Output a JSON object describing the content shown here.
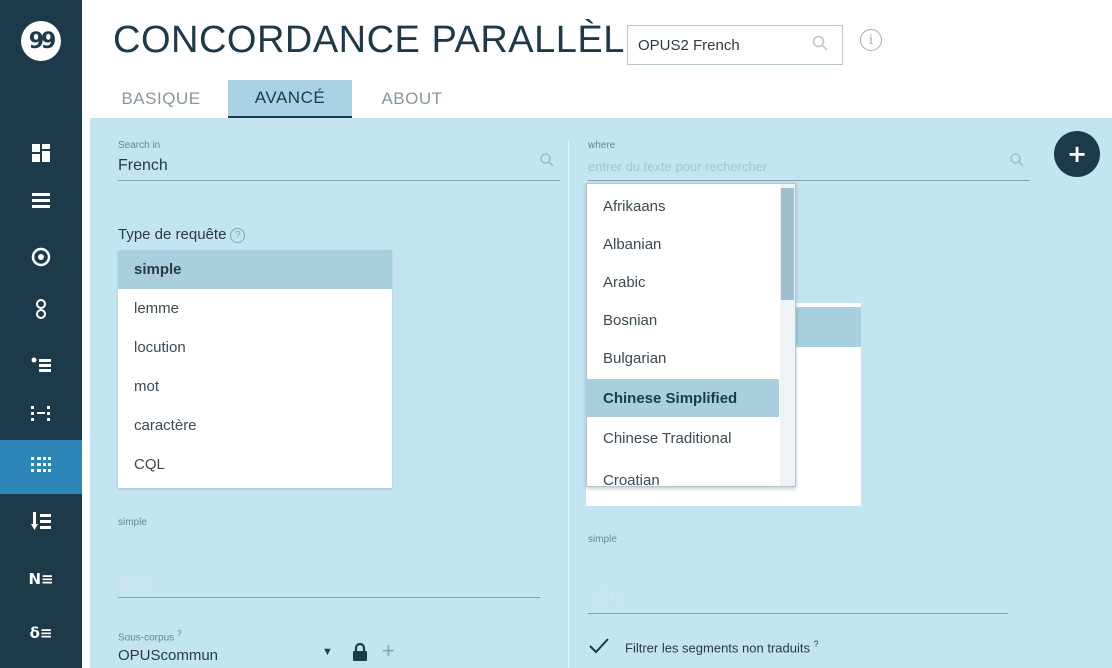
{
  "app": {
    "title": "CONCORDANCE PARALLÈLE",
    "corpus": "OPUS2 French",
    "logo": "99"
  },
  "sidebar": {
    "items": [
      {
        "icon": "dashboard-icon",
        "glyph": "▦"
      },
      {
        "icon": "list-icon",
        "glyph": "☰"
      },
      {
        "icon": "target-icon",
        "glyph": "⊙"
      },
      {
        "icon": "link-icon",
        "glyph": "8"
      },
      {
        "icon": "bullet-list-icon",
        "glyph": "•≡"
      },
      {
        "icon": "dots-list-icon",
        "glyph": "⁞⁝"
      },
      {
        "icon": "parallel-icon",
        "glyph": "⁞⁞",
        "active": true
      },
      {
        "icon": "sort-icon",
        "glyph": "↓≡"
      },
      {
        "icon": "ngram-icon",
        "glyph": "N≡"
      },
      {
        "icon": "keyword-icon",
        "glyph": "δ≡"
      }
    ]
  },
  "tabs": [
    {
      "label": "BASIQUE",
      "active": false
    },
    {
      "label": "AVANCÉ",
      "active": true
    },
    {
      "label": "ABOUT",
      "active": false
    }
  ],
  "left": {
    "search_in_label": "Search in",
    "search_in_value": "French",
    "query_type_label": "Type de requête",
    "query_types": [
      "simple",
      "lemme",
      "locution",
      "mot",
      "caractère",
      "CQL"
    ],
    "query_selected": "simple",
    "input_label": "simple",
    "input_placeholder": "abc",
    "subcorpus_label": "Sous-corpus",
    "subcorpus_sup": "?",
    "subcorpus_value": "OPUScommun"
  },
  "right": {
    "where_label": "where",
    "where_placeholder": "entrer du texte pour rechercher",
    "languages": [
      "Afrikaans",
      "Albanian",
      "Arabic",
      "Bosnian",
      "Bulgarian",
      "Chinese Simplified",
      "Chinese Traditional",
      "Croatian"
    ],
    "language_selected": "Chinese Simplified",
    "input_label": "simple",
    "input_placeholder": "abc",
    "filter_label": "Filtrer les segments non traduits",
    "filter_sup": "?",
    "filter_checked": true
  },
  "colors": {
    "sidebar": "#1d3a4b",
    "panel": "#c3e4f1",
    "accent": "#2d86b8",
    "selected": "#a9cfdf"
  }
}
